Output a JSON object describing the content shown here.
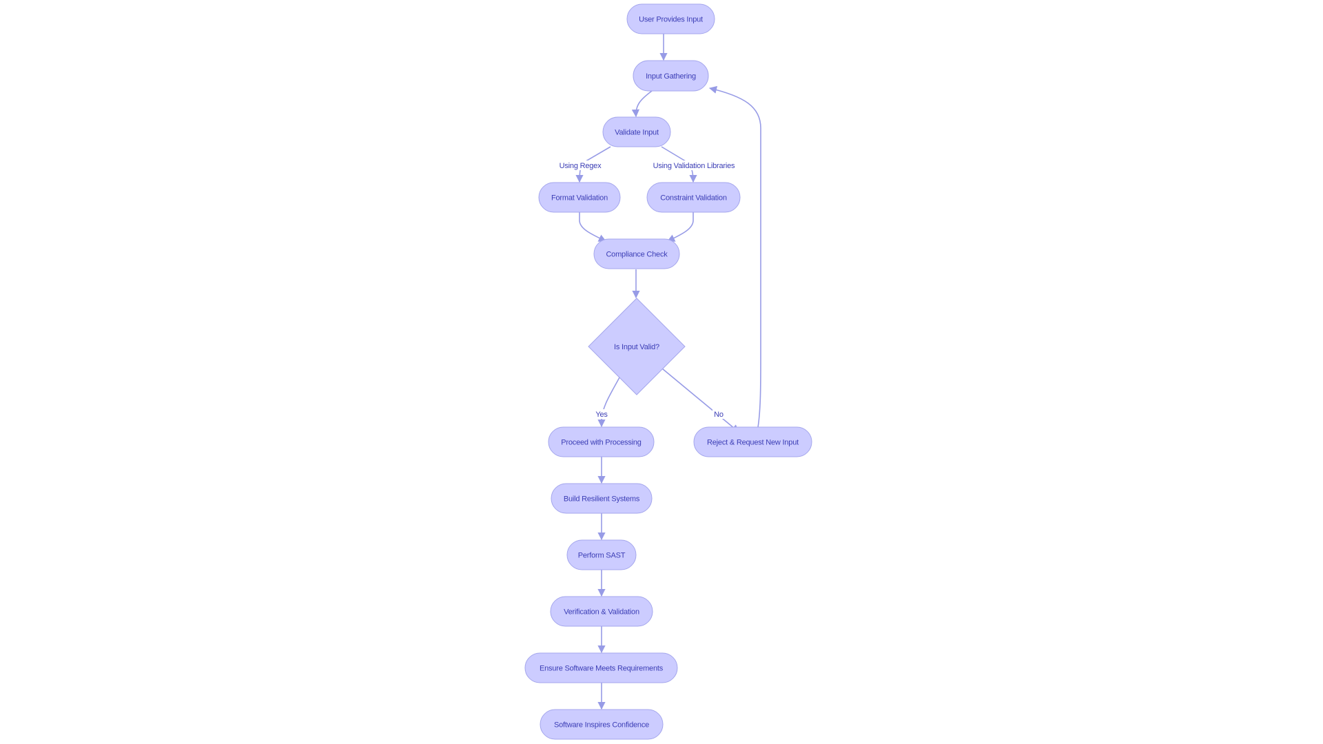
{
  "diagram": {
    "type": "flowchart",
    "direction": "top-down",
    "colors": {
      "node_fill": "#CCCCFF",
      "node_stroke": "#A4A6EC",
      "edge": "#979BE6",
      "text": "#3B3DB5",
      "background": "#FFFFFF"
    },
    "nodes": [
      {
        "id": "user_input",
        "label": "User Provides Input",
        "shape": "rounded"
      },
      {
        "id": "gathering",
        "label": "Input Gathering",
        "shape": "rounded"
      },
      {
        "id": "validate",
        "label": "Validate Input",
        "shape": "rounded"
      },
      {
        "id": "format",
        "label": "Format Validation",
        "shape": "rounded"
      },
      {
        "id": "constraint",
        "label": "Constraint Validation",
        "shape": "rounded"
      },
      {
        "id": "compliance",
        "label": "Compliance Check",
        "shape": "rounded"
      },
      {
        "id": "decision",
        "label": "Is Input Valid?",
        "shape": "diamond"
      },
      {
        "id": "proceed",
        "label": "Proceed with Processing",
        "shape": "rounded"
      },
      {
        "id": "reject",
        "label": "Reject & Request New Input",
        "shape": "rounded"
      },
      {
        "id": "resilient",
        "label": "Build Resilient Systems",
        "shape": "rounded"
      },
      {
        "id": "sast",
        "label": "Perform SAST",
        "shape": "rounded"
      },
      {
        "id": "vv",
        "label": "Verification & Validation",
        "shape": "rounded"
      },
      {
        "id": "requirements",
        "label": "Ensure Software Meets Requirements",
        "shape": "rounded"
      },
      {
        "id": "confidence",
        "label": "Software Inspires Confidence",
        "shape": "rounded"
      }
    ],
    "edges": [
      {
        "from": "user_input",
        "to": "gathering",
        "label": ""
      },
      {
        "from": "gathering",
        "to": "validate",
        "label": ""
      },
      {
        "from": "validate",
        "to": "format",
        "label": "Using Regex"
      },
      {
        "from": "validate",
        "to": "constraint",
        "label": "Using Validation Libraries"
      },
      {
        "from": "format",
        "to": "compliance",
        "label": ""
      },
      {
        "from": "constraint",
        "to": "compliance",
        "label": ""
      },
      {
        "from": "compliance",
        "to": "decision",
        "label": ""
      },
      {
        "from": "decision",
        "to": "proceed",
        "label": "Yes"
      },
      {
        "from": "decision",
        "to": "reject",
        "label": "No"
      },
      {
        "from": "reject",
        "to": "gathering",
        "label": ""
      },
      {
        "from": "proceed",
        "to": "resilient",
        "label": ""
      },
      {
        "from": "resilient",
        "to": "sast",
        "label": ""
      },
      {
        "from": "sast",
        "to": "vv",
        "label": ""
      },
      {
        "from": "vv",
        "to": "requirements",
        "label": ""
      },
      {
        "from": "requirements",
        "to": "confidence",
        "label": ""
      }
    ]
  }
}
